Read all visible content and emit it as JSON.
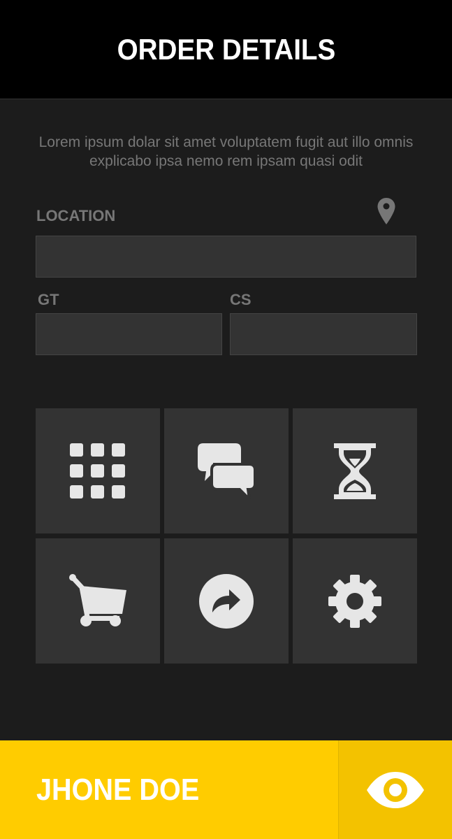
{
  "header": {
    "title": "ORDER DETAILS"
  },
  "intro": {
    "text": "Lorem ipsum dolar sit amet voluptatem fugit aut illo omnis explicabo ipsa nemo rem ipsam quasi odit"
  },
  "form": {
    "location_label": "LOCATION",
    "location_value": "",
    "gt_label": "GT",
    "gt_value": "",
    "cs_label": "CS",
    "cs_value": ""
  },
  "tiles": [
    {
      "icon": "grid-icon"
    },
    {
      "icon": "chat-icon"
    },
    {
      "icon": "hourglass-icon"
    },
    {
      "icon": "cart-icon"
    },
    {
      "icon": "share-icon"
    },
    {
      "icon": "gear-icon"
    }
  ],
  "footer": {
    "user_name": "JHONE DOE",
    "icon": "eye-icon"
  },
  "colors": {
    "accent": "#ffcc00",
    "accent_dark": "#f3c200",
    "background": "#1c1c1c",
    "tile": "#333333",
    "header": "#000000"
  }
}
